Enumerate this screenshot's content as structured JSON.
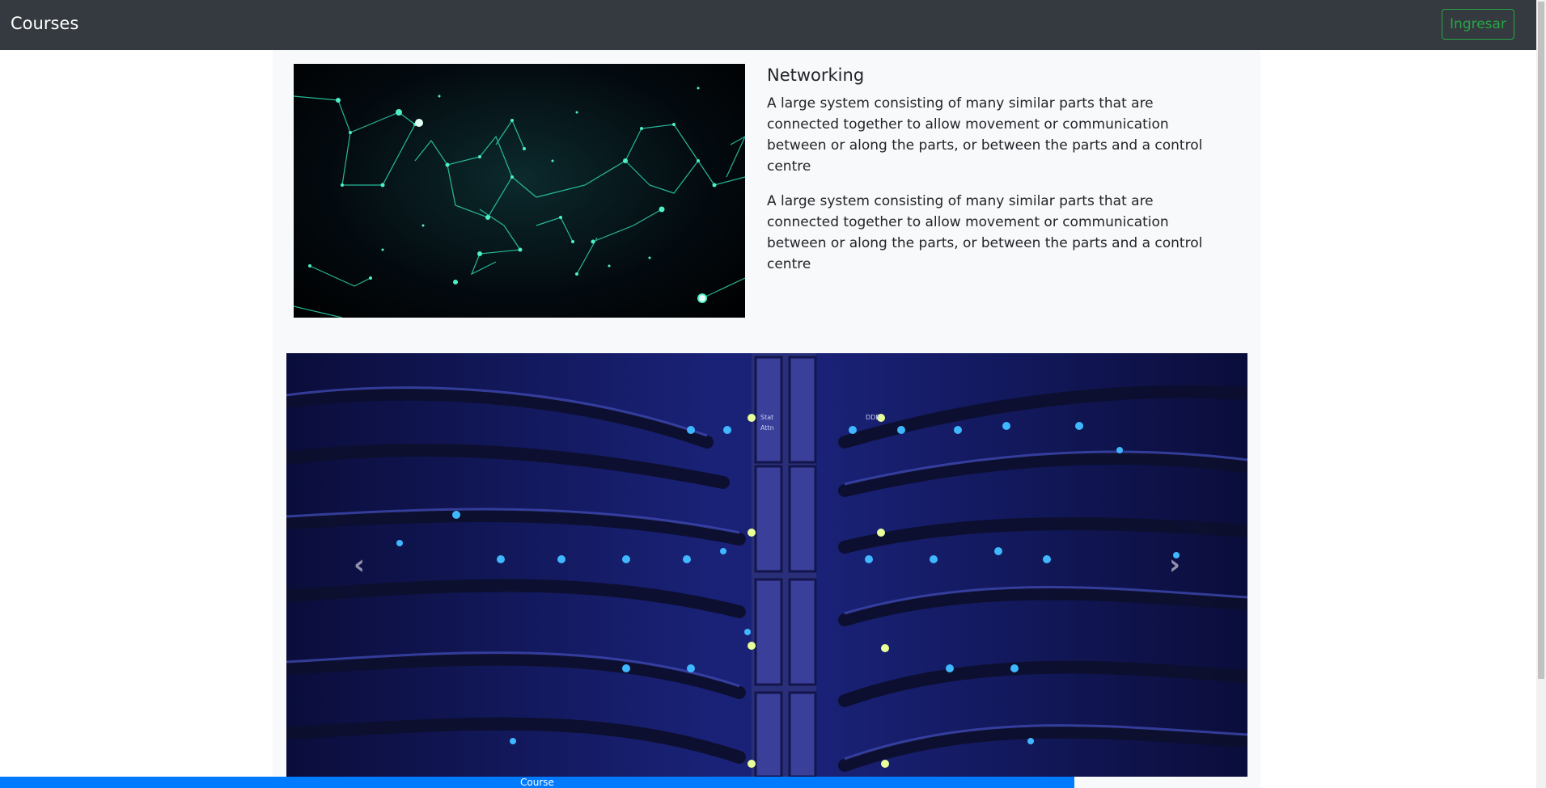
{
  "navbar": {
    "brand": "Courses",
    "login_label": "Ingresar"
  },
  "course": {
    "title": "Networking",
    "paragraphs": [
      "A large system consisting of many similar parts that are connected together to allow movement or communication between or along the parts, or between the parts and a control centre",
      "A large system consisting of many similar parts that are connected together to allow movement or communication between or along the parts, or between the parts and a control centre"
    ],
    "image_icon": "network-constellation-image"
  },
  "carousel": {
    "image_icon": "server-rack-image",
    "rack_labels": [
      "Stat",
      "Attn",
      "DDR"
    ],
    "prev_icon": "chevron-left-icon",
    "next_icon": "chevron-right-icon"
  },
  "bottom_bar": {
    "label": "Course"
  },
  "colors": {
    "navbar": "#343a40",
    "accent_green": "#28a745",
    "progress_blue": "#007bff",
    "panel": "#f8f9fa"
  }
}
